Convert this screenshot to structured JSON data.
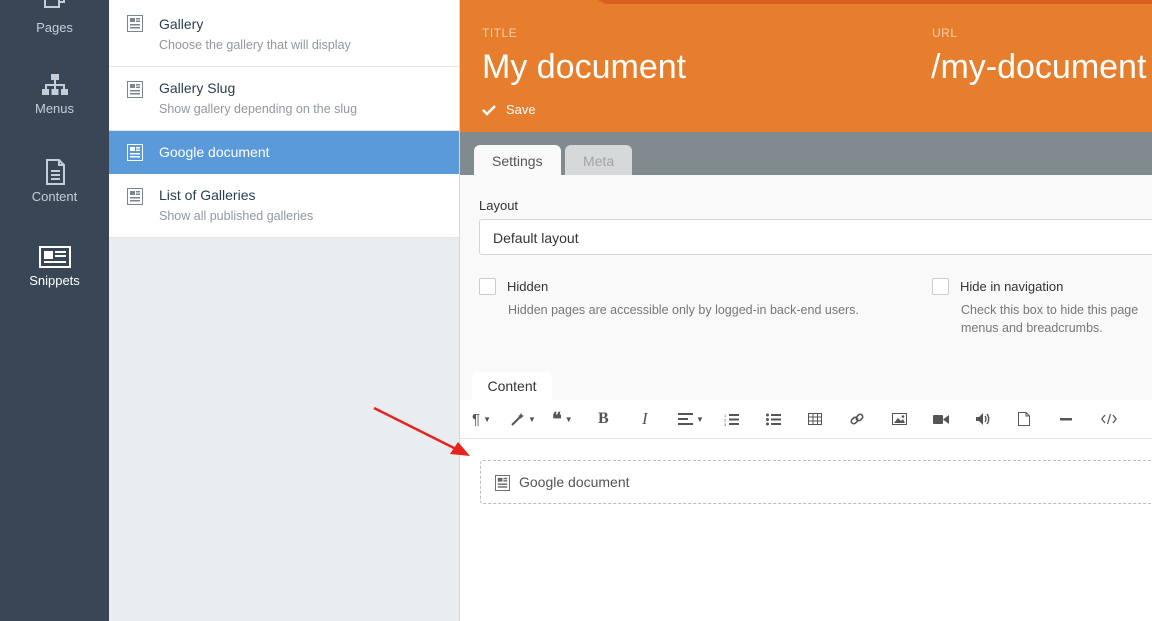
{
  "nav": {
    "items": [
      {
        "label": "Pages",
        "icon": "pages-icon"
      },
      {
        "label": "Menus",
        "icon": "menus-icon"
      },
      {
        "label": "Content",
        "icon": "content-icon"
      },
      {
        "label": "Snippets",
        "icon": "snippets-icon",
        "active": true
      }
    ]
  },
  "snippets": {
    "items": [
      {
        "title": "Gallery",
        "desc": "Choose the gallery that will display"
      },
      {
        "title": "Gallery Slug",
        "desc": "Show gallery depending on the slug"
      },
      {
        "title": "Google document",
        "desc": "",
        "active": true
      },
      {
        "title": "List of Galleries",
        "desc": "Show all published galleries"
      }
    ]
  },
  "header": {
    "title_label": "TITLE",
    "title_value": "My document",
    "url_label": "URL",
    "url_value": "/my-document",
    "save_label": "Save",
    "accent_color": "#e67e2e"
  },
  "tabs": {
    "settings": "Settings",
    "meta": "Meta"
  },
  "form": {
    "layout_label": "Layout",
    "layout_value": "Default layout",
    "hidden_label": "Hidden",
    "hidden_help": "Hidden pages are accessible only by logged-in back-end users.",
    "hide_nav_label": "Hide in navigation",
    "hide_nav_help_1": "Check this box to hide this page",
    "hide_nav_help_2": "menus and breadcrumbs."
  },
  "content": {
    "tab_label": "Content",
    "toolbar": [
      "paragraph-format",
      "magic-style",
      "quote",
      "bold",
      "italic",
      "align",
      "ordered-list",
      "unordered-list",
      "table",
      "link",
      "image",
      "video",
      "audio",
      "file",
      "horizontal-rule",
      "code-view"
    ],
    "snippet_block_label": "Google document"
  },
  "annotation": {
    "color": "#e8231f"
  }
}
